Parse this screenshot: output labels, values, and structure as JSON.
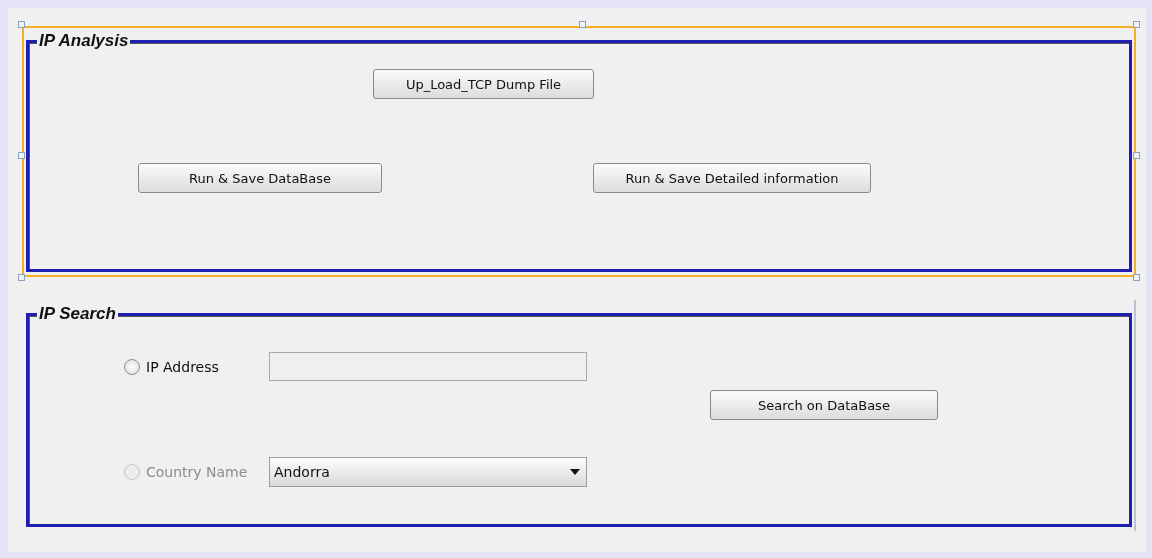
{
  "panels": [
    {
      "kind": "analysis",
      "title": "IP Analysis",
      "selected": true,
      "buttons": [
        "Up_Load_TCP Dump File",
        "Run & Save DataBase",
        "Run & Save Detailed information"
      ]
    },
    {
      "kind": "search",
      "title": "IP Search",
      "selected": false,
      "options": [
        {
          "label": "IP Address",
          "selected": false,
          "disabled": false,
          "field": {
            "kind": "text"
          }
        },
        {
          "label": "Country Name",
          "selected": false,
          "disabled": true,
          "field": {
            "kind": "dropdown",
            "value": "Andorra"
          }
        }
      ],
      "search_button": "Search on DataBase"
    }
  ]
}
